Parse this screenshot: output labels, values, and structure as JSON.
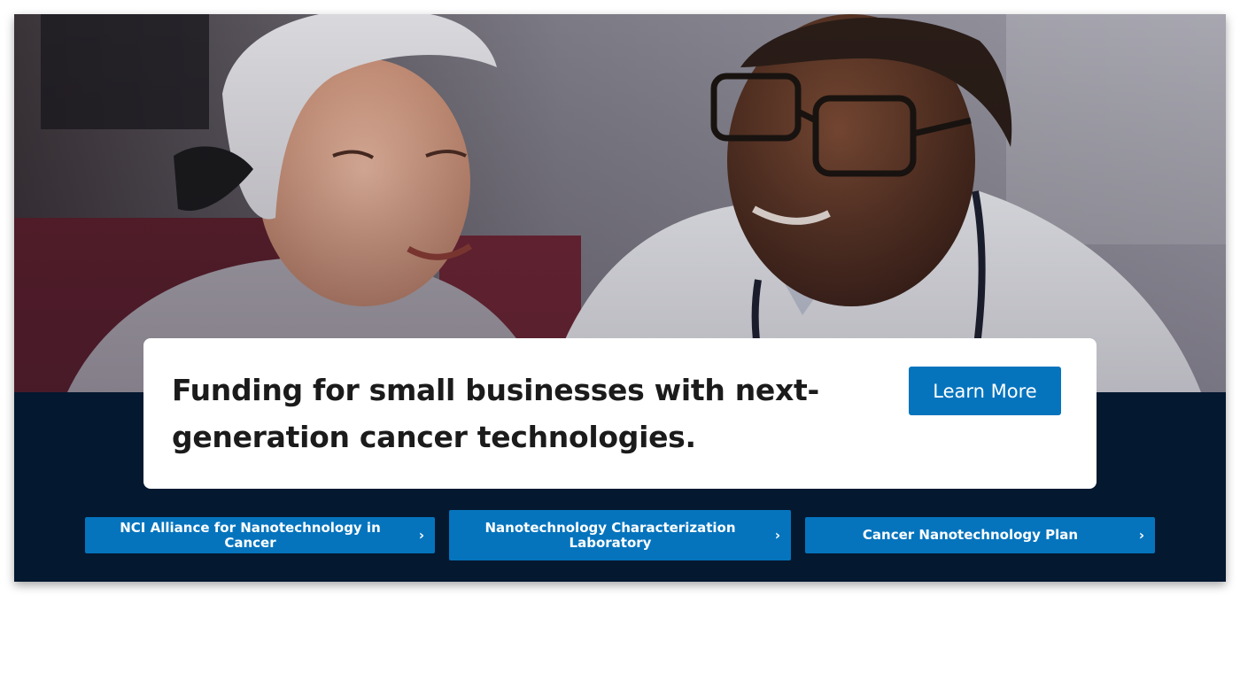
{
  "hero": {
    "image_alt": "Patient in headscarf smiling with doctor wearing stethoscope",
    "promo_text": "Funding for small businesses with next-generation cancer technologies.",
    "cta_label": "Learn More"
  },
  "quick_links": [
    {
      "label": "NCI Alliance for Nanotechnology in Cancer",
      "icon": "chevron-right-icon"
    },
    {
      "label": "Nanotechnology Characterization Laboratory",
      "icon": "chevron-right-icon"
    },
    {
      "label": "Cancer Nanotechnology Plan",
      "icon": "chevron-right-icon"
    }
  ],
  "colors": {
    "accent": "#0574bd",
    "navy_band": "#041830",
    "card": "#ffffff",
    "text": "#1b1b1b"
  }
}
